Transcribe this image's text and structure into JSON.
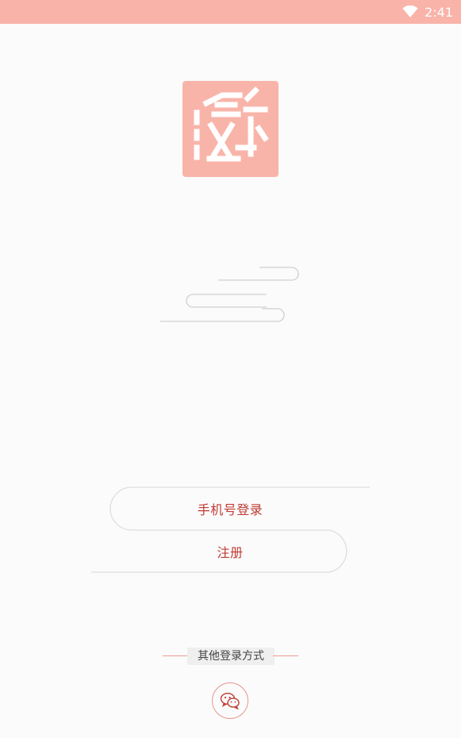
{
  "status_bar": {
    "time": "2:41",
    "background_color": "#f9b3a9",
    "icons": [
      "wifi-icon"
    ]
  },
  "logo": {
    "icon": "app-logo-icon",
    "color": "#f9b4a9"
  },
  "decor": {
    "icon": "cloud-lines-icon"
  },
  "buttons": {
    "phone_login_label": "手机号登录",
    "register_label": "注册",
    "text_color": "#c03b34"
  },
  "other_login": {
    "label": "其他登录方式",
    "wechat_icon": "wechat-icon",
    "accent_color": "#e89993"
  }
}
